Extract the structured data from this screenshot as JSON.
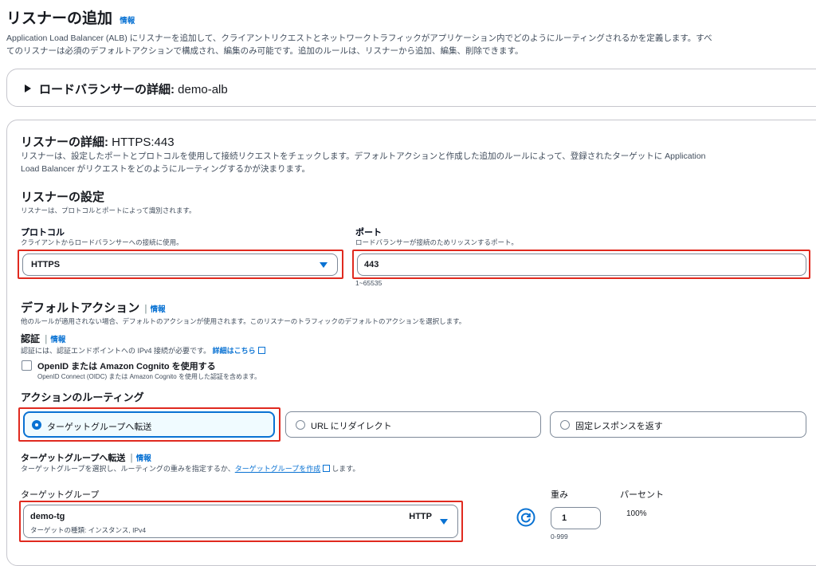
{
  "page": {
    "title": "リスナーの追加",
    "info": "情報",
    "description_line1": "Application Load Balancer (ALB) にリスナーを追加して、クライアントリクエストとネットワークトラフィックがアプリケーション内でどのようにルーティングされるかを定義します。すべ",
    "description_line2": "てのリスナーは必須のデフォルトアクションで構成され、編集のみ可能です。追加のルールは、リスナーから追加、編集、削除できます。"
  },
  "lb_details": {
    "toggle_icon": "triangle-right-icon",
    "title_prefix": "ロードバランサーの詳細: ",
    "name": "demo-alb"
  },
  "listener": {
    "title_prefix": "リスナーの詳細: ",
    "title_value": "HTTPS:443",
    "desc_line1": "リスナーは、設定したポートとプロトコルを使用して接続リクエストをチェックします。デフォルトアクションと作成した追加のルールによって、登録されたターゲットに Application",
    "desc_line2": "Load Balancer がリクエストをどのようにルーティングするかが決まります。",
    "settings_title": "リスナーの設定",
    "settings_desc": "リスナーは、プロトコルとポートによって識別されます。",
    "protocol_label": "プロトコル",
    "protocol_desc": "クライアントからロードバランサーへの接続に使用。",
    "protocol_value": "HTTPS",
    "port_label": "ポート",
    "port_desc": "ロードバランサーが接続のためリッスンするポート。",
    "port_value": "443",
    "port_hint": "1~65535"
  },
  "default_action": {
    "title": "デフォルトアクション",
    "info": "情報",
    "desc": "他のルールが適用されない場合、デフォルトのアクションが使用されます。このリスナーのトラフィックのデフォルトのアクションを選択します。",
    "auth_title": "認証",
    "auth_info": "情報",
    "auth_desc": "認証には、認証エンドポイントへの IPv4 接続が必要です。",
    "auth_link": "詳細はこちら",
    "oidc_label": "OpenID または Amazon Cognito を使用する",
    "oidc_desc": "OpenID Connect (OIDC) または Amazon Cognito を使用した認証を含めます。",
    "routing_title": "アクションのルーティング",
    "routing_options": [
      "ターゲットグループへ転送",
      "URL にリダイレクト",
      "固定レスポンスを返す"
    ],
    "forward_title": "ターゲットグループへ転送",
    "forward_info": "情報",
    "forward_desc_pre": "ターゲットグループを選択し、ルーティングの重みを指定するか、",
    "forward_desc_link": "ターゲットグループを作成",
    "forward_desc_post": "します。",
    "tg_label": "ターゲットグループ",
    "tg_name": "demo-tg",
    "tg_protocol": "HTTP",
    "tg_type": "ターゲットの種類: インスタンス, IPv4",
    "weight_label": "重み",
    "weight_value": "1",
    "weight_hint": "0-999",
    "percent_label": "パーセント",
    "percent_value": "100%"
  },
  "icons": {
    "refresh": "refresh-icon",
    "external": "external-link-icon",
    "checkbox": "checkbox-unchecked"
  },
  "colors": {
    "accent": "#0972d3",
    "highlight": "#e02a1f"
  }
}
